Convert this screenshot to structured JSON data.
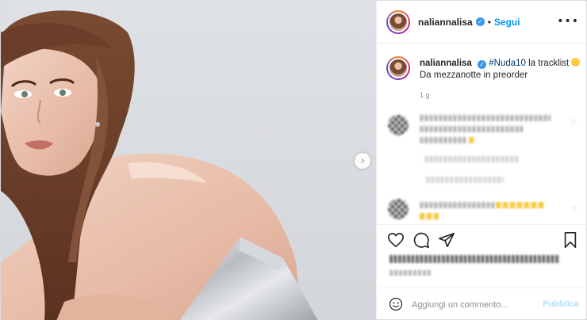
{
  "post": {
    "username": "naliannalisa",
    "follow_label": "Segui",
    "more_label": "•••",
    "caption": {
      "username": "naliannalisa",
      "hashtag": "#Nuda10",
      "text": " la tracklist",
      "line2": "Da mezzanotte in preorder"
    },
    "time": "1 g",
    "next_label": "›"
  },
  "comment_box": {
    "placeholder": "Aggiungi un commento...",
    "publish_label": "Pubblica"
  },
  "icons": {
    "verified": "verified-badge-icon",
    "like": "heart-icon",
    "comment": "comment-bubble-icon",
    "share": "paper-plane-icon",
    "save": "bookmark-icon",
    "emoji": "smiley-icon",
    "next": "chevron-right-icon"
  },
  "colors": {
    "link_blue": "#0095f6",
    "verified_blue": "#3897f0",
    "hashtag": "#00376b",
    "publish_disabled": "#b2dffc"
  }
}
